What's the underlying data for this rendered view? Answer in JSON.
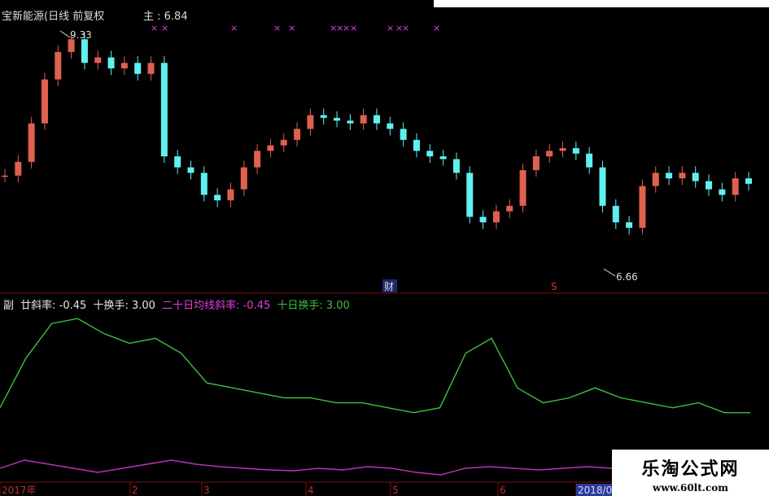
{
  "header": {
    "title": "宝新能源(日线 前复权",
    "price_label": "主 : 6.84"
  },
  "sub_indicator": {
    "prefix": "副",
    "items": [
      {
        "label": "廿斜率: -0.45",
        "color": "#e8e8e8"
      },
      {
        "label": "十换手: 3.00",
        "color": "#e8e8e8"
      },
      {
        "label": "二十日均线斜率: -0.45",
        "color": "#e040e0"
      },
      {
        "label": "十日换手: 3.00",
        "color": "#3fbf3f"
      }
    ]
  },
  "markers": {
    "high": "9.33",
    "low": "6.66",
    "cai": "财",
    "s": "S",
    "x_marks": [
      "×",
      "×",
      "×",
      "×",
      "×",
      "×",
      "×",
      "×",
      "×",
      "×",
      "×",
      "×",
      "×"
    ]
  },
  "x_axis_labels": [
    "2017年",
    "2",
    "3",
    "4",
    "5",
    "6",
    "2018/06"
  ],
  "watermark": {
    "big": "乐淘公式网",
    "small": "www.60lt.com"
  },
  "colors": {
    "up": "#e06050",
    "down": "#5ff0f0",
    "green_line": "#3fbf3f",
    "pink_line": "#c030c0",
    "divider": "#7a1010",
    "axis_text": "#c03030"
  },
  "chart_data": [
    {
      "type": "line",
      "title": "宝新能源(日线 前复权",
      "series": [
        {
          "name": "收盘价",
          "values": [
            6.85,
            7.1,
            7.8,
            8.6,
            9.1,
            9.33,
            8.9,
            9.0,
            8.8,
            8.9,
            8.7,
            8.9,
            7.2,
            7.0,
            6.9,
            6.5,
            6.4,
            6.6,
            7.0,
            7.3,
            7.4,
            7.5,
            7.7,
            7.95,
            7.9,
            7.85,
            7.8,
            7.95,
            7.8,
            7.7,
            7.5,
            7.3,
            7.2,
            7.15,
            6.9,
            6.1,
            6.0,
            6.2,
            6.3,
            6.95,
            7.2,
            7.3,
            7.35,
            7.25,
            7.0,
            6.3,
            6.0,
            5.9,
            6.66,
            6.9,
            6.8,
            6.9,
            6.75,
            6.6,
            6.5,
            6.8,
            6.7
          ]
        }
      ],
      "price_high": 9.33,
      "price_low": 6.66,
      "price_now": 6.84
    },
    {
      "type": "line",
      "title": "副",
      "series": [
        {
          "name": "廿斜率",
          "values": [
            0.1,
            0.6,
            0.95,
            1.0,
            0.85,
            0.75,
            0.8,
            0.65,
            0.35,
            0.3,
            0.25,
            0.2,
            0.2,
            0.15,
            0.15,
            0.1,
            0.05,
            0.1,
            0.65,
            0.8,
            0.3,
            0.15,
            0.2,
            0.3,
            0.2,
            0.15,
            0.1,
            0.15,
            0.05,
            0.05
          ]
        },
        {
          "name": "二十日均线斜率",
          "values": [
            -0.3,
            -0.2,
            -0.25,
            -0.3,
            -0.35,
            -0.3,
            -0.25,
            -0.2,
            -0.25,
            -0.28,
            -0.3,
            -0.32,
            -0.33,
            -0.3,
            -0.32,
            -0.28,
            -0.3,
            -0.35,
            -0.38,
            -0.3,
            -0.28,
            -0.3,
            -0.32,
            -0.3,
            -0.28,
            -0.3
          ]
        }
      ]
    }
  ]
}
